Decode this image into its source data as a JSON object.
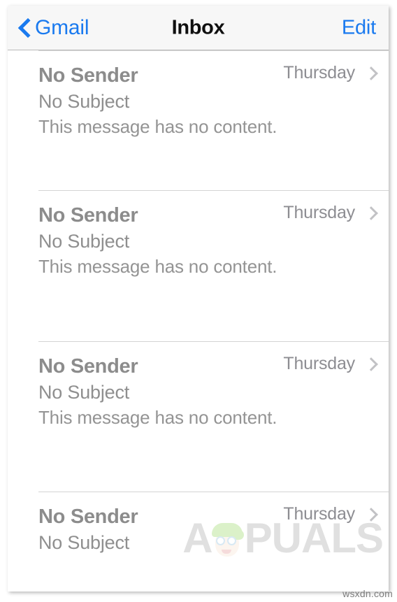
{
  "nav": {
    "back_label": "Gmail",
    "back_icon": "chevron-left-icon",
    "title": "Inbox",
    "edit_label": "Edit"
  },
  "colors": {
    "accent_blue": "#1a7aef",
    "title_text": "#101010",
    "sender_text": "#8c8c8c",
    "subject_text": "#8f8f8f",
    "preview_text": "#949494",
    "date_text": "#8d8d92",
    "chevron_gray": "#c2c2c5",
    "nav_background": "#f7f7f7",
    "separator": "#d4d4d4"
  },
  "mail_list": {
    "rows": [
      {
        "sender": "No Sender",
        "subject": "No Subject",
        "preview": "This message has no content.",
        "date": "Thursday",
        "disclosure_icon": "chevron-right-icon"
      },
      {
        "sender": "No Sender",
        "subject": "No Subject",
        "preview": "This message has no content.",
        "date": "Thursday",
        "disclosure_icon": "chevron-right-icon"
      },
      {
        "sender": "No Sender",
        "subject": "No Subject",
        "preview": "This message has no content.",
        "date": "Thursday",
        "disclosure_icon": "chevron-right-icon"
      },
      {
        "sender": "No Sender",
        "subject": "No Subject",
        "preview": "",
        "date": "Thursday",
        "disclosure_icon": "chevron-right-icon"
      }
    ]
  },
  "watermarks": {
    "appuals_prefix": "A",
    "appuals_suffix": "PUALS",
    "appuals_logo_icon": "appuals-mascot-icon",
    "site": "wsxdn.com"
  }
}
